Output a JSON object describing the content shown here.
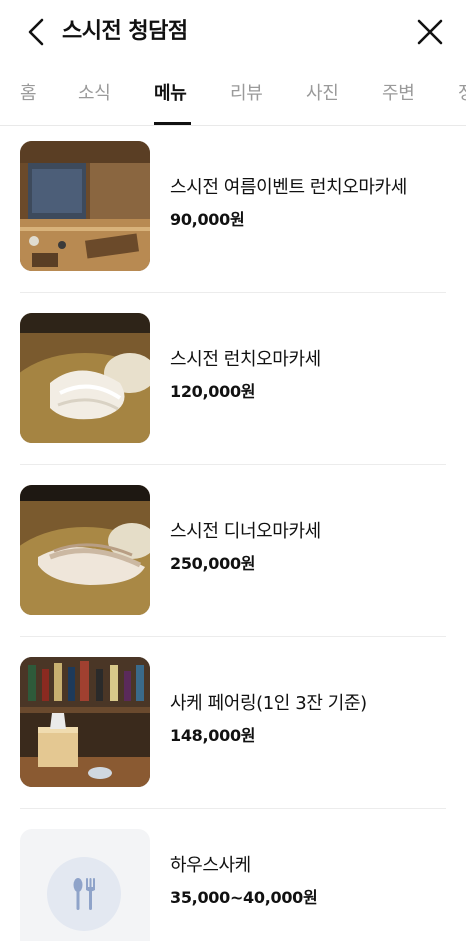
{
  "header": {
    "title": "스시전 청담점",
    "back_icon": "chevron-left-icon",
    "close_icon": "close-icon"
  },
  "tabs": [
    {
      "label": "홈",
      "active": false
    },
    {
      "label": "소식",
      "active": false
    },
    {
      "label": "메뉴",
      "active": true
    },
    {
      "label": "리뷰",
      "active": false
    },
    {
      "label": "사진",
      "active": false
    },
    {
      "label": "주변",
      "active": false
    },
    {
      "label": "정",
      "active": false
    }
  ],
  "menu": {
    "items": [
      {
        "name": "스시전 여름이벤트 런치오마카세",
        "price": "90,000원",
        "image": "restaurant-interior-photo"
      },
      {
        "name": "스시전 런치오마카세",
        "price": "120,000원",
        "image": "sushi-photo"
      },
      {
        "name": "스시전 디너오마카세",
        "price": "250,000원",
        "image": "sushi-photo"
      },
      {
        "name": "사케 페어링(1인 3잔 기준)",
        "price": "148,000원",
        "image": "sake-photo"
      },
      {
        "name": "하우스사케",
        "price": "35,000~40,000원",
        "image": "utensils-icon"
      }
    ]
  },
  "colors": {
    "text": "#111111",
    "tab_inactive": "#9a9a9a",
    "divider": "#ececec",
    "placeholder_bg": "#f3f4f6",
    "icon_accent": "#8fa3c9"
  }
}
